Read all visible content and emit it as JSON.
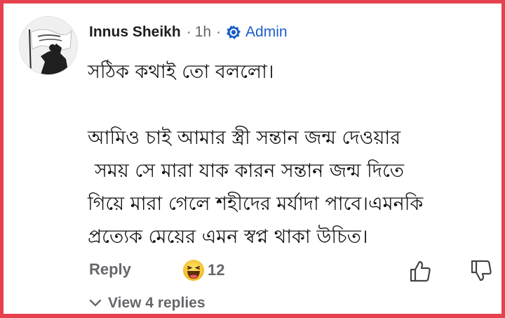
{
  "comment": {
    "author": "Innus Sheikh",
    "time": "1h",
    "badge": {
      "icon": "admin-badge-icon",
      "label": "Admin"
    },
    "paragraphs": [
      [
        "সঠিক কথাই তো বললো।"
      ],
      [
        "আমিও চাই আমার স্ত্রী সন্তান জন্ম দেওয়ার",
        "সময় সে মারা যাক কারন সন্তান জন্ম দিতে",
        "গিয়ে মারা গেলে শহীদের মর্যাদা পাবে।এমনকি",
        "প্রত্যেক মেয়ের এমন স্বপ্ন থাকা উচিত।"
      ]
    ],
    "actions": {
      "reply_label": "Reply",
      "reaction_icon": "haha-emoji-icon",
      "reaction_count": "12",
      "like_icon": "thumbs-up-icon",
      "dislike_icon": "thumbs-down-icon"
    },
    "view_replies_label": "View 4 replies"
  },
  "colors": {
    "frame_border": "#e5424e",
    "admin_blue": "#1b5fc8",
    "secondary_text": "#65676b",
    "emoji_yellow": "#f7c531"
  }
}
